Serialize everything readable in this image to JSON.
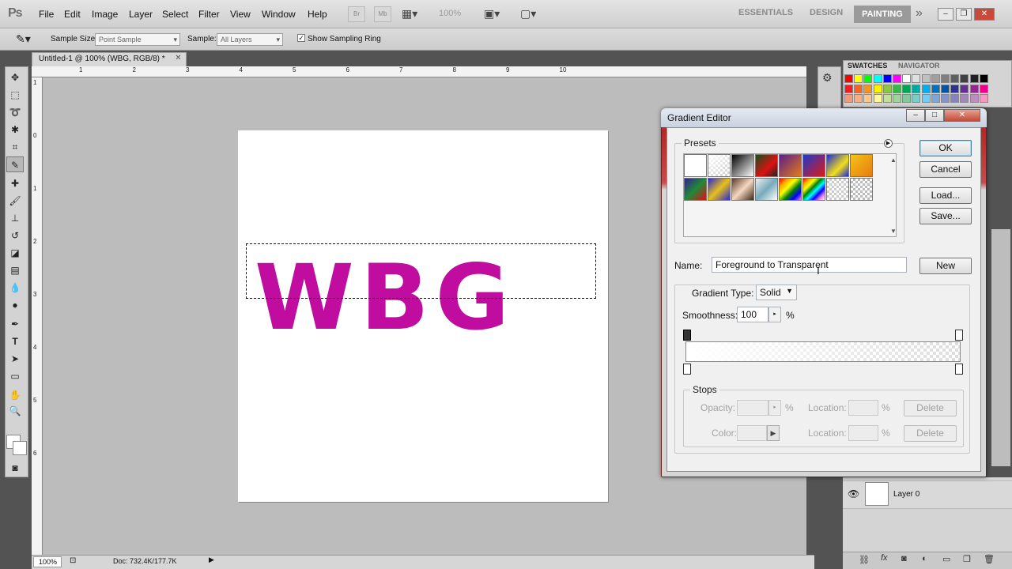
{
  "menubar": {
    "logo": "Ps",
    "menus": [
      "File",
      "Edit",
      "Image",
      "Layer",
      "Select",
      "Filter",
      "View",
      "Window",
      "Help"
    ],
    "br_label": "Br",
    "mb_label": "Mb",
    "zoom": "100%",
    "workspaces": [
      "ESSENTIALS",
      "DESIGN",
      "PAINTING"
    ],
    "more": "»"
  },
  "options": {
    "sample_size_label": "Sample Size:",
    "sample_size_value": "Point Sample",
    "sample_label": "Sample:",
    "sample_value": "All Layers",
    "show_ring_label": "Show Sampling Ring",
    "show_ring_checked": true
  },
  "document": {
    "tab_title": "Untitled-1 @ 100% (WBG, RGB/8) *",
    "text": "WBG",
    "text_color": "#c10d9f",
    "ruler_h": [
      "1",
      "2",
      "3",
      "4",
      "5",
      "6",
      "7",
      "8",
      "9",
      "10"
    ],
    "ruler_v": [
      "1",
      "0",
      "1",
      "2",
      "3",
      "4",
      "5",
      "6"
    ],
    "status_zoom": "100%",
    "status_doc": "Doc: 732.4K/177.7K"
  },
  "panels": {
    "swatches_tab": "SWATCHES",
    "navigator_tab": "NAVIGATOR",
    "layer_name": "Layer 0"
  },
  "dialog": {
    "title": "Gradient Editor",
    "presets_label": "Presets",
    "ok": "OK",
    "cancel": "Cancel",
    "load": "Load...",
    "save": "Save...",
    "name_label": "Name:",
    "name_value": "Foreground to Transparent",
    "new_button": "New",
    "gradient_type_label": "Gradient Type:",
    "gradient_type_value": "Solid",
    "smoothness_label": "Smoothness:",
    "smoothness_value": "100",
    "percent": "%",
    "stops_label": "Stops",
    "opacity_label": "Opacity:",
    "color_label": "Color:",
    "location_label": "Location:",
    "delete_label": "Delete"
  }
}
